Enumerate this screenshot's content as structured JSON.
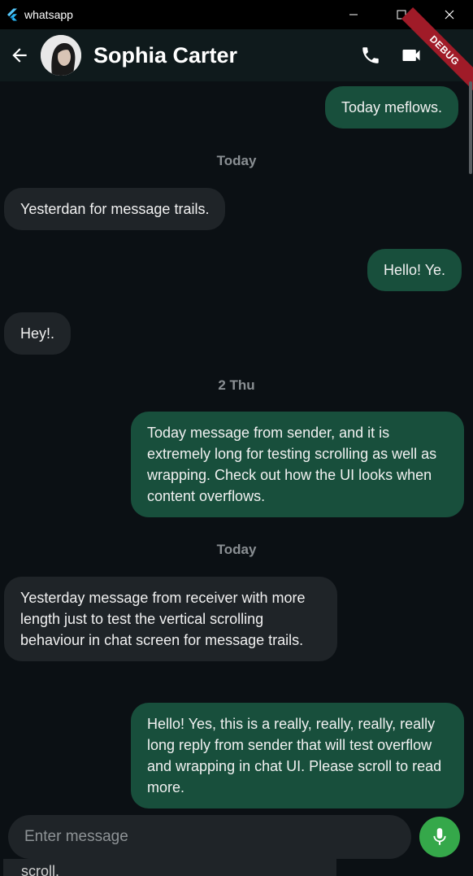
{
  "window": {
    "title": "whatsapp"
  },
  "header": {
    "contact_name": "Sophia Carter",
    "debug_label": "DEBUG"
  },
  "messages": [
    {
      "type": "out",
      "text": "Today meflows."
    },
    {
      "type": "date",
      "text": "Today"
    },
    {
      "type": "in",
      "text": "Yesterdan for message trails."
    },
    {
      "type": "out",
      "text": "Hello! Ye."
    },
    {
      "type": "in",
      "text": "Hey!."
    },
    {
      "type": "date",
      "text": "2 Thu"
    },
    {
      "type": "out",
      "text": "Today message from sender, and it is extremely long for testing scrolling as well as wrapping. Check out how the UI looks when content overflows."
    },
    {
      "type": "date",
      "text": "Today"
    },
    {
      "type": "in",
      "text": "Yesterday message from receiver with more length just to test the vertical scrolling behaviour in chat screen for message trails."
    },
    {
      "type": "out",
      "text": "Hello! Yes, this is a really, really, really, really long reply from sender that will test overflow and wrapping in chat UI. Please scroll to read more."
    }
  ],
  "composer": {
    "placeholder": "Enter message",
    "peek_text": "scroll."
  },
  "colors": {
    "outgoing_bubble": "#184f3c",
    "incoming_bubble": "#1f2428",
    "mic_button": "#35a84a",
    "background": "#0b1014"
  },
  "icons": [
    "flutter-icon",
    "minimize-icon",
    "maximize-icon",
    "close-icon",
    "back-arrow-icon",
    "phone-icon",
    "video-camera-icon",
    "mic-icon"
  ]
}
